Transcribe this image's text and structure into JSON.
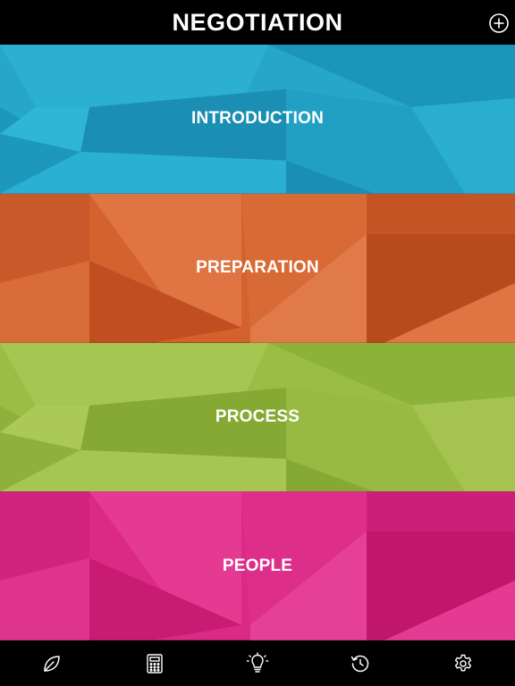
{
  "header": {
    "title": "NEGOTIATION",
    "add_icon": "plus-circle-icon"
  },
  "sections": [
    {
      "label": "INTRODUCTION",
      "color": "#26a6c9"
    },
    {
      "label": "PREPARATION",
      "color": "#d4622e"
    },
    {
      "label": "PROCESS",
      "color": "#9cbd45"
    },
    {
      "label": "PEOPLE",
      "color": "#db2a86"
    }
  ],
  "tabbar": {
    "items": [
      {
        "icon": "leaf-icon"
      },
      {
        "icon": "calculator-icon"
      },
      {
        "icon": "lightbulb-icon"
      },
      {
        "icon": "history-icon"
      },
      {
        "icon": "gear-icon"
      }
    ]
  }
}
